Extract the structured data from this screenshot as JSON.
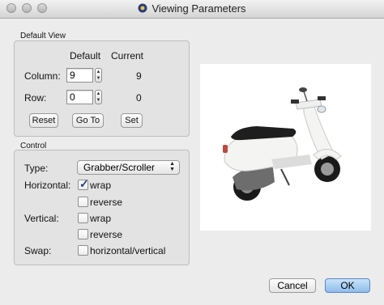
{
  "window": {
    "title": "Viewing Parameters"
  },
  "default_view": {
    "group_label": "Default View",
    "col_default_header": "Default",
    "col_current_header": "Current",
    "column": {
      "label": "Column:",
      "value": "9",
      "current": "9"
    },
    "row": {
      "label": "Row:",
      "value": "0",
      "current": "0"
    },
    "buttons": {
      "reset": "Reset",
      "goto": "Go To",
      "set": "Set"
    }
  },
  "control": {
    "group_label": "Control",
    "type_label": "Type:",
    "type_value": "Grabber/Scroller",
    "horizontal_label": "Horizontal:",
    "horizontal_wrap": {
      "label": "wrap",
      "checked": true
    },
    "horizontal_reverse": {
      "label": "reverse",
      "checked": false
    },
    "vertical_label": "Vertical:",
    "vertical_wrap": {
      "label": "wrap",
      "checked": false
    },
    "vertical_reverse": {
      "label": "reverse",
      "checked": false
    },
    "swap_label": "Swap:",
    "swap_hv": {
      "label": "horizontal/vertical",
      "checked": false
    }
  },
  "preview": {
    "image_name": "scooter-image"
  },
  "footer": {
    "cancel": "Cancel",
    "ok": "OK"
  },
  "colors": {
    "ok_button": "#9cc7f2",
    "scooter_body": "#f4f4f2",
    "seat": "#1e1e1e"
  }
}
